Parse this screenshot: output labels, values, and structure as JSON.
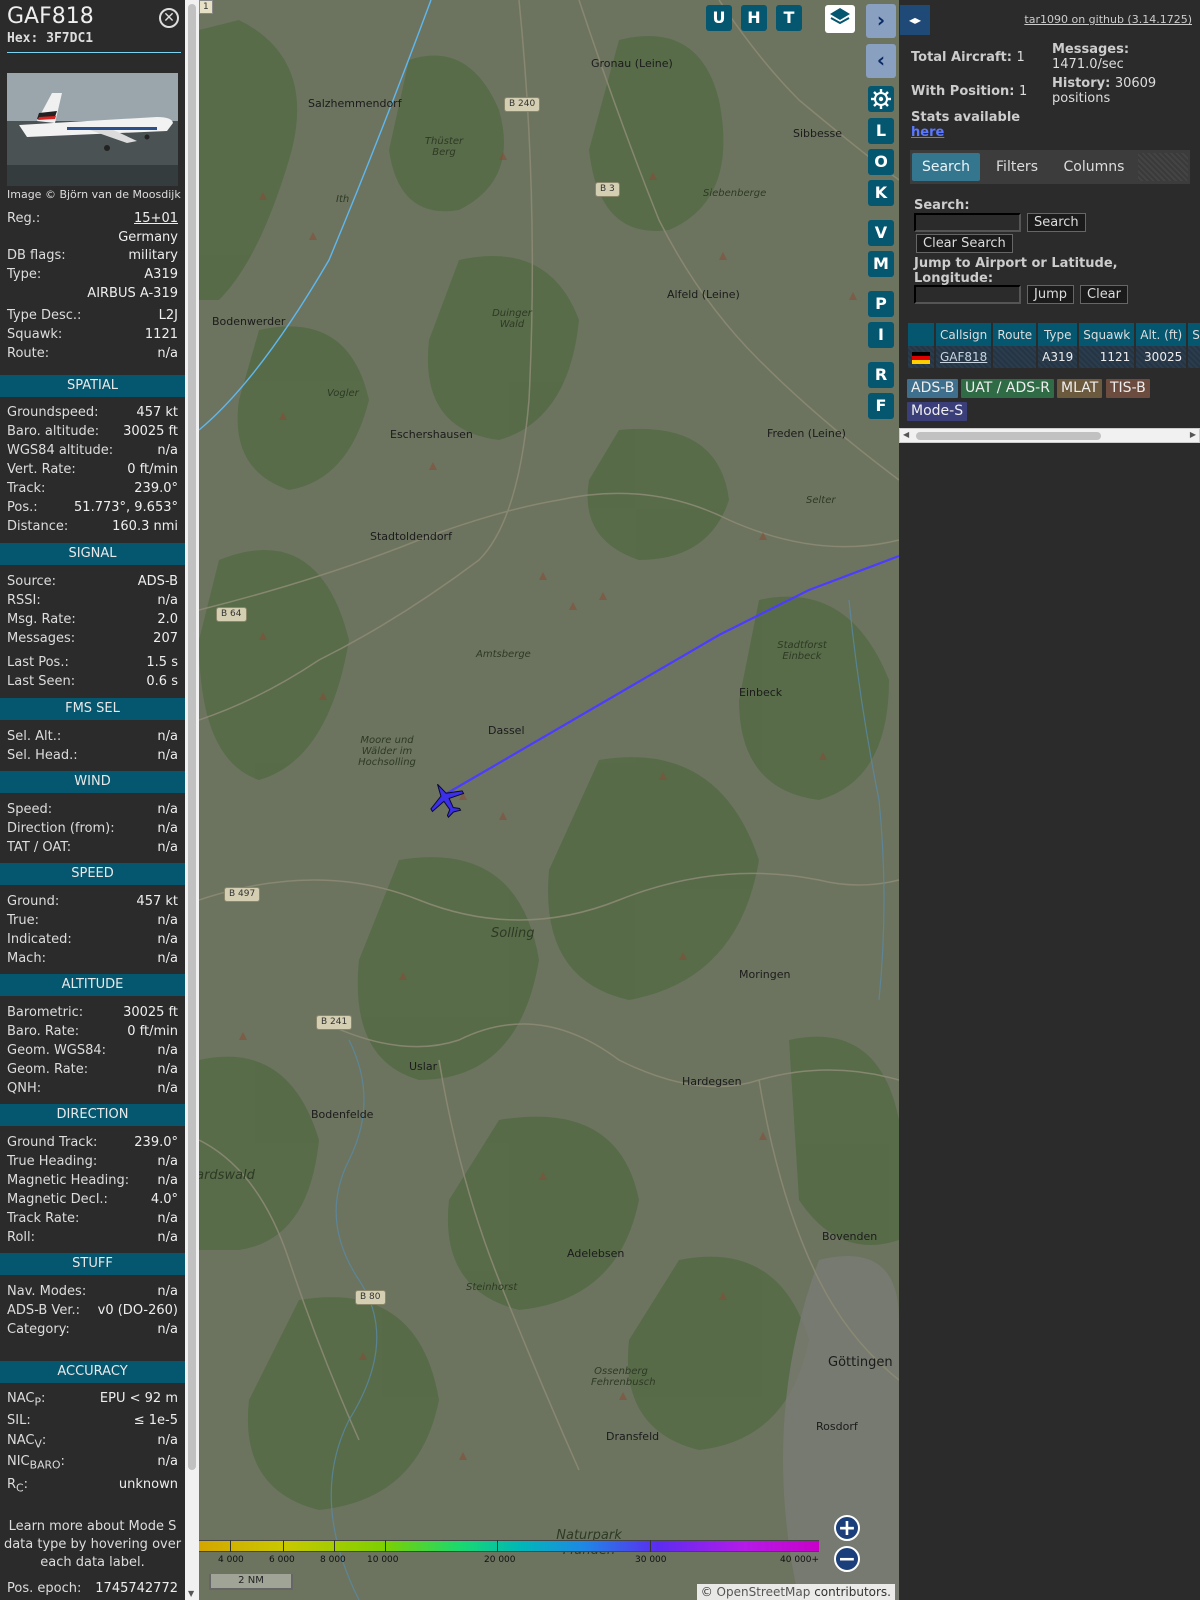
{
  "aircraft": {
    "callsign": "GAF818",
    "hex": "Hex: 3F7DC1",
    "image_credit": "Image © Björn van de Moosdijk"
  },
  "details": {
    "reg_label": "Reg.:",
    "reg": "15+01",
    "country": "Germany",
    "dbflags_label": "DB flags:",
    "dbflags": "military",
    "type_label": "Type:",
    "type": "A319",
    "type_full": "AIRBUS A-319",
    "typedesc_label": "Type Desc.:",
    "typedesc": "L2J",
    "squawk_label": "Squawk:",
    "squawk": "1121",
    "route_label": "Route:",
    "route": "n/a"
  },
  "spatial": {
    "title": "SPATIAL",
    "rows": [
      {
        "k": "Groundspeed:",
        "v": "457 kt"
      },
      {
        "k": "Baro. altitude:",
        "v": "30025 ft"
      },
      {
        "k": "WGS84 altitude:",
        "v": "n/a"
      },
      {
        "k": "Vert. Rate:",
        "v": "0 ft/min"
      },
      {
        "k": "Track:",
        "v": "239.0°"
      },
      {
        "k": "Pos.:",
        "v": "51.773°, 9.653°"
      },
      {
        "k": "Distance:",
        "v": "160.3 nmi"
      }
    ]
  },
  "signal": {
    "title": "SIGNAL",
    "rows": [
      {
        "k": "Source:",
        "v": "ADS-B"
      },
      {
        "k": "RSSI:",
        "v": "n/a"
      },
      {
        "k": "Msg. Rate:",
        "v": "2.0"
      },
      {
        "k": "Messages:",
        "v": "207"
      },
      {
        "k": "Last Pos.:",
        "v": "1.5 s"
      },
      {
        "k": "Last Seen:",
        "v": "0.6 s"
      }
    ]
  },
  "fms": {
    "title": "FMS SEL",
    "rows": [
      {
        "k": "Sel. Alt.:",
        "v": "n/a"
      },
      {
        "k": "Sel. Head.:",
        "v": "n/a"
      }
    ]
  },
  "wind": {
    "title": "WIND",
    "rows": [
      {
        "k": "Speed:",
        "v": "n/a"
      },
      {
        "k": "Direction (from):",
        "v": "n/a"
      },
      {
        "k": "TAT / OAT:",
        "v": "n/a"
      }
    ]
  },
  "speed": {
    "title": "SPEED",
    "rows": [
      {
        "k": "Ground:",
        "v": "457 kt"
      },
      {
        "k": "True:",
        "v": "n/a"
      },
      {
        "k": "Indicated:",
        "v": "n/a"
      },
      {
        "k": "Mach:",
        "v": "n/a"
      }
    ]
  },
  "altitude": {
    "title": "ALTITUDE",
    "rows": [
      {
        "k": "Barometric:",
        "v": "30025 ft"
      },
      {
        "k": "Baro. Rate:",
        "v": "0 ft/min"
      },
      {
        "k": "Geom. WGS84:",
        "v": "n/a"
      },
      {
        "k": "Geom. Rate:",
        "v": "n/a"
      },
      {
        "k": "QNH:",
        "v": "n/a"
      }
    ]
  },
  "direction": {
    "title": "DIRECTION",
    "rows": [
      {
        "k": "Ground Track:",
        "v": "239.0°"
      },
      {
        "k": "True Heading:",
        "v": "n/a"
      },
      {
        "k": "Magnetic Heading:",
        "v": "n/a"
      },
      {
        "k": "Magnetic Decl.:",
        "v": "4.0°"
      },
      {
        "k": "Track Rate:",
        "v": "n/a"
      },
      {
        "k": "Roll:",
        "v": "n/a"
      }
    ]
  },
  "stuff": {
    "title": "STUFF",
    "rows": [
      {
        "k": "Nav. Modes:",
        "v": "n/a"
      },
      {
        "k": "ADS-B Ver.:",
        "v": "v0 (DO-260)"
      },
      {
        "k": "Category:",
        "v": "n/a"
      }
    ]
  },
  "accuracy": {
    "title": "ACCURACY",
    "nacp_k": "NAC",
    "nacp_sub": "P",
    "nacp_v": "EPU < 92 m",
    "sil_k": "SIL:",
    "sil_v": "≤ 1e-5",
    "nacv_k": "NAC",
    "nacv_sub": "V",
    "nacv_v": "n/a",
    "nicbaro_k": "NIC",
    "nicbaro_sub": "BARO",
    "nicbaro_v": "n/a",
    "rc_k": "R",
    "rc_sub": "C",
    "rc_v": "unknown",
    "note": "Learn more about Mode S data type by hovering over each data label.",
    "epoch_k": "Pos. epoch:",
    "epoch_v": "1745742772"
  },
  "map": {
    "buttons": {
      "u": "U",
      "h": "H",
      "t": "T",
      "next": "›",
      "prev": "‹",
      "l": "L",
      "o": "O",
      "k": "K",
      "v": "V",
      "m": "M",
      "p": "P",
      "i": "I",
      "r": "R",
      "f": "F"
    },
    "corner_tile": "1",
    "places": [
      "Gronau (Leine)",
      "Salzhemmendorf",
      "Sibbesse",
      "Siebenberge",
      "Alfeld (Leine)",
      "Bodenwerder",
      "Vogler",
      "Eschershausen",
      "Freden (Leine)",
      "Stadtoldendorf",
      "Amtsberge",
      "Einbeck",
      "Dassel",
      "Solling",
      "Moringen",
      "Uslar",
      "Hardegsen",
      "Bodenfelde",
      "Adelebsen",
      "Bovenden",
      "Göttingen",
      "Rosdorf",
      "Dransfeld",
      "Thüster Berg",
      "Duinger Wald",
      "Ith",
      "Stadtforst Einbeck",
      "Selter",
      "Moore und Wälder im Hochsolling",
      "Reinhardswald",
      "Steinhorst",
      "Ossenberg Fehrenbusch",
      "Naturpark Münden"
    ],
    "roads": [
      "B 240",
      "B 3",
      "B 64",
      "B 497",
      "B 241",
      "B 80"
    ],
    "altitude_legend": [
      "4 000",
      "6 000",
      "8 000",
      "10 000",
      "20 000",
      "30 000",
      "40 000+"
    ],
    "scale": "2 NM",
    "attribution_prefix": "© ",
    "attribution_link": "OpenStreetMap",
    "attribution_suffix": " contributors.",
    "zoom_in": "+",
    "zoom_out": "−"
  },
  "right": {
    "toggle": "◂▸",
    "github": "tar1090 on github (3.14.1725)",
    "total_label": "Total Aircraft:",
    "total": "1",
    "pos_label": "With Position:",
    "pos": "1",
    "messages_label": "Messages:",
    "messages": "1471.0/sec",
    "history_label": "History:",
    "history": "30609 positions",
    "stats_label": "Stats available",
    "stats_link": "here",
    "tabs": [
      "Search",
      "Filters",
      "Columns"
    ],
    "search_label": "Search:",
    "search_value": "",
    "search_btn": "Search",
    "clear_search_btn": "Clear Search",
    "jump_label": "Jump to Airport or Latitude, Longitude:",
    "jump_value": "",
    "jump_btn": "Jump",
    "clear_btn": "Clear",
    "table": {
      "headers": [
        "",
        "Callsign",
        "Route",
        "Type",
        "Squawk",
        "Alt. (ft)",
        "Spd."
      ],
      "row": {
        "callsign": "GAF818",
        "route": "",
        "type": "A319",
        "squawk": "1121",
        "alt": "30025",
        "spd": ""
      }
    },
    "sources": [
      "ADS-B",
      "UAT / ADS-R",
      "MLAT",
      "TIS-B",
      "Mode-S"
    ]
  },
  "colors": {
    "section_bg": "#05566f",
    "track_line": "#4b3cff",
    "aircraft_fill": "#3b2fe8"
  }
}
